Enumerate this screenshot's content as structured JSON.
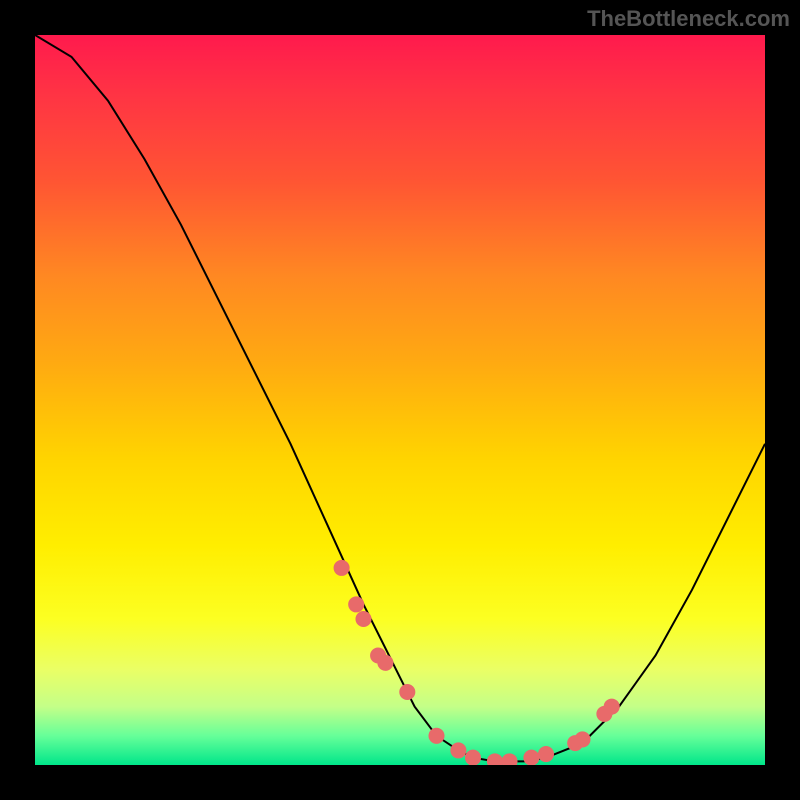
{
  "attribution": "TheBottleneck.com",
  "chart_data": {
    "type": "line",
    "title": "",
    "xlabel": "",
    "ylabel": "",
    "xlim": [
      0,
      100
    ],
    "ylim": [
      0,
      100
    ],
    "series": [
      {
        "name": "curve",
        "x": [
          0,
          5,
          10,
          15,
          20,
          25,
          30,
          35,
          40,
          45,
          50,
          52,
          55,
          58,
          60,
          63,
          67,
          70,
          75,
          80,
          85,
          90,
          95,
          100
        ],
        "y": [
          100,
          97,
          91,
          83,
          74,
          64,
          54,
          44,
          33,
          22,
          12,
          8,
          4,
          2,
          1,
          0.5,
          0.5,
          1,
          3,
          8,
          15,
          24,
          34,
          44
        ]
      }
    ],
    "markers": {
      "name": "dots",
      "x": [
        42,
        44,
        45,
        47,
        48,
        51,
        55,
        58,
        60,
        63,
        65,
        68,
        70,
        74,
        75,
        78,
        79
      ],
      "y": [
        27,
        22,
        20,
        15,
        14,
        10,
        4,
        2,
        1,
        0.5,
        0.5,
        1,
        1.5,
        3,
        3.5,
        7,
        8
      ]
    },
    "marker_color": "#e86a6a",
    "curve_color": "#000000"
  }
}
